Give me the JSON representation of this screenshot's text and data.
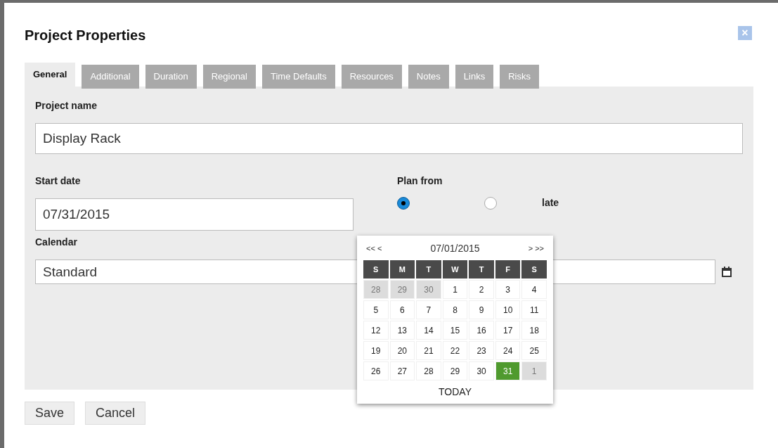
{
  "dialog": {
    "title": "Project Properties",
    "close": "×"
  },
  "tabs": [
    {
      "label": "General",
      "selected": true
    },
    {
      "label": "Additional",
      "selected": false
    },
    {
      "label": "Duration",
      "selected": false
    },
    {
      "label": "Regional",
      "selected": false
    },
    {
      "label": "Time Defaults",
      "selected": false
    },
    {
      "label": "Resources",
      "selected": false
    },
    {
      "label": "Notes",
      "selected": false
    },
    {
      "label": "Links",
      "selected": false
    },
    {
      "label": "Risks",
      "selected": false
    }
  ],
  "project_name": {
    "label": "Project name",
    "value": "Display Rack"
  },
  "start_date": {
    "label": "Start date",
    "value": "07/31/2015"
  },
  "plan_from": {
    "label": "Plan from",
    "options": [
      {
        "selected": true
      },
      {
        "label": "late",
        "selected": false
      }
    ]
  },
  "calendar": {
    "label": "Calendar",
    "value": "Standard"
  },
  "datepicker": {
    "prev": "<< <",
    "month": "07/01/2015",
    "next": "> >>",
    "weekdays": [
      "S",
      "M",
      "T",
      "W",
      "T",
      "F",
      "S"
    ],
    "weeks": [
      [
        {
          "day": "28",
          "outside": true,
          "selected": false
        },
        {
          "day": "29",
          "outside": true,
          "selected": false
        },
        {
          "day": "30",
          "outside": true,
          "selected": false
        },
        {
          "day": "1",
          "outside": false,
          "selected": false
        },
        {
          "day": "2",
          "outside": false,
          "selected": false
        },
        {
          "day": "3",
          "outside": false,
          "selected": false
        },
        {
          "day": "4",
          "outside": false,
          "selected": false
        }
      ],
      [
        {
          "day": "5",
          "outside": false,
          "selected": false
        },
        {
          "day": "6",
          "outside": false,
          "selected": false
        },
        {
          "day": "7",
          "outside": false,
          "selected": false
        },
        {
          "day": "8",
          "outside": false,
          "selected": false
        },
        {
          "day": "9",
          "outside": false,
          "selected": false
        },
        {
          "day": "10",
          "outside": false,
          "selected": false
        },
        {
          "day": "11",
          "outside": false,
          "selected": false
        }
      ],
      [
        {
          "day": "12",
          "outside": false,
          "selected": false
        },
        {
          "day": "13",
          "outside": false,
          "selected": false
        },
        {
          "day": "14",
          "outside": false,
          "selected": false
        },
        {
          "day": "15",
          "outside": false,
          "selected": false
        },
        {
          "day": "16",
          "outside": false,
          "selected": false
        },
        {
          "day": "17",
          "outside": false,
          "selected": false
        },
        {
          "day": "18",
          "outside": false,
          "selected": false
        }
      ],
      [
        {
          "day": "19",
          "outside": false,
          "selected": false
        },
        {
          "day": "20",
          "outside": false,
          "selected": false
        },
        {
          "day": "21",
          "outside": false,
          "selected": false
        },
        {
          "day": "22",
          "outside": false,
          "selected": false
        },
        {
          "day": "23",
          "outside": false,
          "selected": false
        },
        {
          "day": "24",
          "outside": false,
          "selected": false
        },
        {
          "day": "25",
          "outside": false,
          "selected": false
        }
      ],
      [
        {
          "day": "26",
          "outside": false,
          "selected": false
        },
        {
          "day": "27",
          "outside": false,
          "selected": false
        },
        {
          "day": "28",
          "outside": false,
          "selected": false
        },
        {
          "day": "29",
          "outside": false,
          "selected": false
        },
        {
          "day": "30",
          "outside": false,
          "selected": false
        },
        {
          "day": "31",
          "outside": false,
          "selected": true
        },
        {
          "day": "1",
          "outside": true,
          "selected": false
        }
      ]
    ],
    "today": "TODAY"
  },
  "buttons": [
    "Save",
    "Cancel"
  ]
}
